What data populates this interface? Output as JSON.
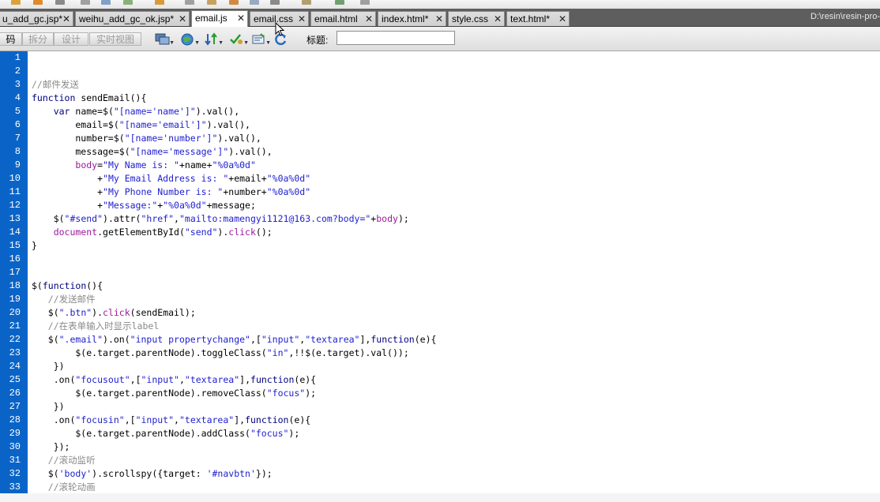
{
  "tabs": [
    {
      "label": "u_add_gc.jsp*",
      "active": false
    },
    {
      "label": "weihu_add_gc_ok.jsp*",
      "active": false
    },
    {
      "label": "email.js",
      "active": true
    },
    {
      "label": "email.css",
      "active": false
    },
    {
      "label": "email.html",
      "active": false
    },
    {
      "label": "index.html*",
      "active": false
    },
    {
      "label": "style.css",
      "active": false
    },
    {
      "label": "text.html*",
      "active": false
    }
  ],
  "path": "D:\\resin\\resin-pro-",
  "toolbar": {
    "view_buttons": [
      "码",
      "拆分",
      "设计",
      "实时视图"
    ],
    "title_label": "标题:",
    "title_value": ""
  },
  "colors": {
    "gutter": "#0a64c8",
    "tabbar": "#5e5e5e",
    "comment": "#8a8a8a",
    "keyword": "#000080",
    "string": "#2020d0"
  },
  "editor": {
    "line_numbers": [
      "1",
      "2",
      "3",
      "4",
      "5",
      "6",
      "7",
      "8",
      "9",
      "10",
      "11",
      "12",
      "13",
      "14",
      "15",
      "16",
      "17",
      "18",
      "19",
      "20",
      "21",
      "22",
      "23",
      "24",
      "25",
      "26",
      "27",
      "28",
      "29",
      "30",
      "31",
      "32",
      "33"
    ],
    "lines": [
      [],
      [],
      [
        [
          "cm",
          "//邮件发送"
        ]
      ],
      [
        [
          "kw",
          "function "
        ],
        [
          "pl",
          "sendEmail(){"
        ]
      ],
      [
        [
          "pl",
          "    "
        ],
        [
          "kw",
          "var "
        ],
        [
          "pl",
          "name=$("
        ],
        [
          "str",
          "\"[name='name']\""
        ],
        [
          "pl",
          ").val(),"
        ]
      ],
      [
        [
          "pl",
          "        email=$("
        ],
        [
          "str",
          "\"[name='email']\""
        ],
        [
          "pl",
          ").val(),"
        ]
      ],
      [
        [
          "pl",
          "        number=$("
        ],
        [
          "str",
          "\"[name='number']\""
        ],
        [
          "pl",
          ").val(),"
        ]
      ],
      [
        [
          "pl",
          "        message=$("
        ],
        [
          "str",
          "\"[name='message']\""
        ],
        [
          "pl",
          ").val(),"
        ]
      ],
      [
        [
          "pl",
          "        "
        ],
        [
          "m",
          "body"
        ],
        [
          "pl",
          "="
        ],
        [
          "str",
          "\"My Name is: \""
        ],
        [
          "pl",
          "+name+"
        ],
        [
          "str",
          "\"%0a%0d\""
        ]
      ],
      [
        [
          "pl",
          "            +"
        ],
        [
          "str",
          "\"My Email Address is: \""
        ],
        [
          "pl",
          "+email+"
        ],
        [
          "str",
          "\"%0a%0d\""
        ]
      ],
      [
        [
          "pl",
          "            +"
        ],
        [
          "str",
          "\"My Phone Number is: \""
        ],
        [
          "pl",
          "+number+"
        ],
        [
          "str",
          "\"%0a%0d\""
        ]
      ],
      [
        [
          "pl",
          "            +"
        ],
        [
          "str",
          "\"Message:\""
        ],
        [
          "pl",
          "+"
        ],
        [
          "str",
          "\"%0a%0d\""
        ],
        [
          "pl",
          "+message;"
        ]
      ],
      [
        [
          "pl",
          "    $("
        ],
        [
          "str",
          "\"#send\""
        ],
        [
          "pl",
          ").attr("
        ],
        [
          "str",
          "\"href\""
        ],
        [
          "pl",
          ","
        ],
        [
          "str",
          "\"mailto:mamengyi1121@163.com?body=\""
        ],
        [
          "pl",
          "+"
        ],
        [
          "m",
          "body"
        ],
        [
          "pl",
          ");"
        ]
      ],
      [
        [
          "pl",
          "    "
        ],
        [
          "m",
          "document"
        ],
        [
          "pl",
          ".getElementById("
        ],
        [
          "str",
          "\"send\""
        ],
        [
          "pl",
          ")."
        ],
        [
          "m",
          "click"
        ],
        [
          "pl",
          "();"
        ]
      ],
      [
        [
          "pl",
          "}"
        ]
      ],
      [],
      [],
      [
        [
          "pl",
          "$("
        ],
        [
          "kw",
          "function"
        ],
        [
          "pl",
          "(){"
        ]
      ],
      [
        [
          "pl",
          "   "
        ],
        [
          "cm",
          "//发送邮件"
        ]
      ],
      [
        [
          "pl",
          "   $("
        ],
        [
          "str",
          "\".btn\""
        ],
        [
          "pl",
          ")."
        ],
        [
          "m",
          "click"
        ],
        [
          "pl",
          "(sendEmail);"
        ]
      ],
      [
        [
          "pl",
          "   "
        ],
        [
          "cm",
          "//在表单输入时显示label"
        ]
      ],
      [
        [
          "pl",
          "   $("
        ],
        [
          "str",
          "\".email\""
        ],
        [
          "pl",
          ").on("
        ],
        [
          "str",
          "\"input propertychange\""
        ],
        [
          "pl",
          ",["
        ],
        [
          "str",
          "\"input\""
        ],
        [
          "pl",
          ","
        ],
        [
          "str",
          "\"textarea\""
        ],
        [
          "pl",
          "],"
        ],
        [
          "kw",
          "function"
        ],
        [
          "pl",
          "(e){"
        ]
      ],
      [
        [
          "pl",
          "        $(e.target.parentNode).toggleClass("
        ],
        [
          "str",
          "\"in\""
        ],
        [
          "pl",
          ",!!$(e.target).val());"
        ]
      ],
      [
        [
          "pl",
          "    })"
        ]
      ],
      [
        [
          "pl",
          "    .on("
        ],
        [
          "str",
          "\"focusout\""
        ],
        [
          "pl",
          ",["
        ],
        [
          "str",
          "\"input\""
        ],
        [
          "pl",
          ","
        ],
        [
          "str",
          "\"textarea\""
        ],
        [
          "pl",
          "],"
        ],
        [
          "kw",
          "function"
        ],
        [
          "pl",
          "(e){"
        ]
      ],
      [
        [
          "pl",
          "        $(e.target.parentNode).removeClass("
        ],
        [
          "str",
          "\"focus\""
        ],
        [
          "pl",
          ");"
        ]
      ],
      [
        [
          "pl",
          "    })"
        ]
      ],
      [
        [
          "pl",
          "    .on("
        ],
        [
          "str",
          "\"focusin\""
        ],
        [
          "pl",
          ",["
        ],
        [
          "str",
          "\"input\""
        ],
        [
          "pl",
          ","
        ],
        [
          "str",
          "\"textarea\""
        ],
        [
          "pl",
          "],"
        ],
        [
          "kw",
          "function"
        ],
        [
          "pl",
          "(e){"
        ]
      ],
      [
        [
          "pl",
          "        $(e.target.parentNode).addClass("
        ],
        [
          "str",
          "\"focus\""
        ],
        [
          "pl",
          ");"
        ]
      ],
      [
        [
          "pl",
          "    });"
        ]
      ],
      [
        [
          "pl",
          "   "
        ],
        [
          "cm",
          "//滚动监听"
        ]
      ],
      [
        [
          "pl",
          "   $("
        ],
        [
          "str",
          "'body'"
        ],
        [
          "pl",
          ").scrollspy({target: "
        ],
        [
          "str",
          "'#navbtn'"
        ],
        [
          "pl",
          "});"
        ]
      ],
      [
        [
          "pl",
          "   "
        ],
        [
          "cm",
          "//滚轮动画"
        ]
      ]
    ]
  }
}
